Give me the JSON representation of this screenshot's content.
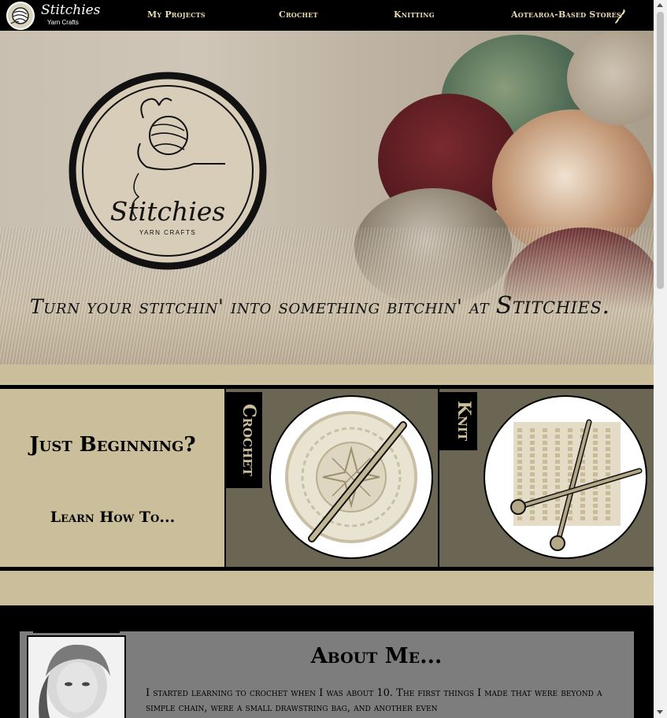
{
  "nav": {
    "brand": "Stitchies",
    "brand_sub": "Yarn Crafts",
    "links": [
      "My Projects",
      "Crochet",
      "Knitting",
      "Aotearoa-Based Stores"
    ]
  },
  "hero": {
    "logo_title": "Stitchies",
    "logo_sub": "YARN CRAFTS",
    "tagline_main": "Turn your stitchin' into something bitchin' at ",
    "tagline_brand": "Stitchies."
  },
  "learn": {
    "heading": "Just Beginning?",
    "sub": "Learn How To...",
    "crochet_tag": "Crochet",
    "knit_tag": "Knit"
  },
  "about": {
    "title": "About Me...",
    "body": "I started learning to crochet when I was about 10. The first things I made that were beyond a simple chain, were a small drawstring bag, and another even"
  },
  "colors": {
    "tan": "#cbbe9b",
    "panel": "#6b6553",
    "nav_link": "#e8dbb0"
  }
}
